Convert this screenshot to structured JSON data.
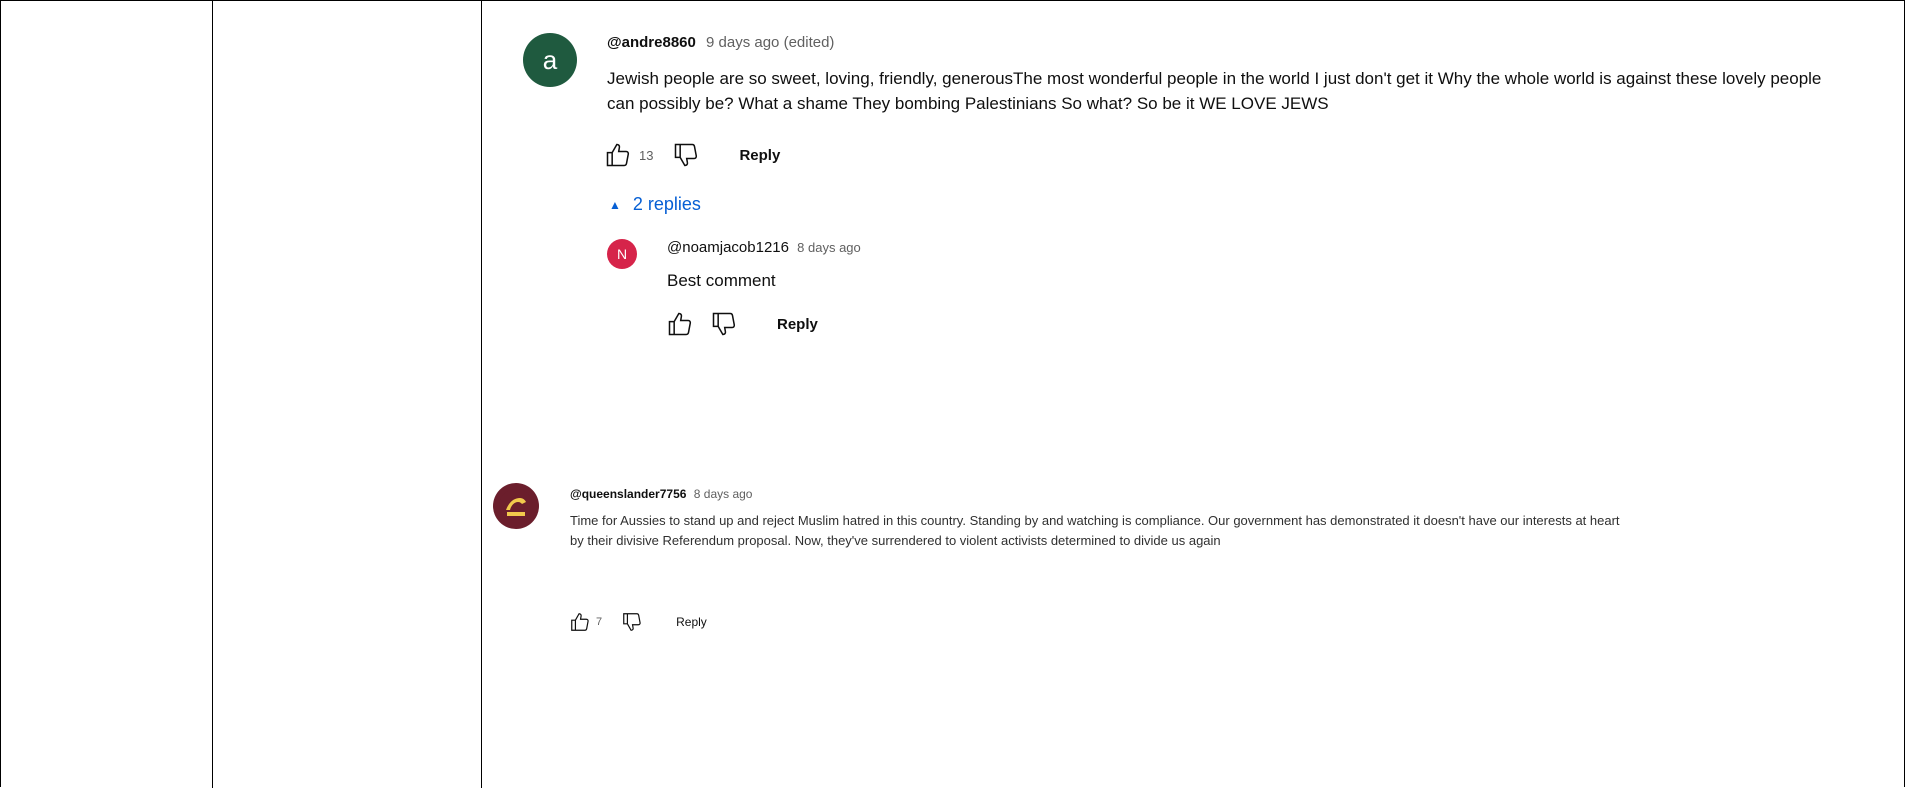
{
  "comments": [
    {
      "avatar_letter": "a",
      "avatar_color": "#1f5a3f",
      "author": "@andre8860",
      "time": "9 days ago (edited)",
      "text": "Jewish people are so sweet, loving, friendly, generousThe most wonderful people in the world I just don't get it Why the whole world is against these lovely people can possibly be? What a shame They bombing Palestinians So what? So be it WE LOVE JEWS",
      "likes": "13",
      "reply_label": "Reply",
      "replies_toggle": "2 replies",
      "replies": [
        {
          "avatar_letter": "N",
          "avatar_color": "#d6244a",
          "author": "@noamjacob1216",
          "time": "8 days ago",
          "text": "Best comment",
          "reply_label": "Reply"
        }
      ]
    },
    {
      "avatar_color": "#6b1e2c",
      "author": "@queenslander7756",
      "time": "8 days ago",
      "text": "Time for Aussies to stand up and reject Muslim hatred in this country. Standing by and watching is compliance. Our government has demonstrated it doesn't have our interests at heart by their divisive Referendum proposal. Now, they've surrendered to violent activists determined to divide us again",
      "likes": "7",
      "reply_label": "Reply"
    }
  ],
  "icons": {
    "like": "thumb-up-icon",
    "dislike": "thumb-down-icon",
    "collapse": "caret-up-icon"
  }
}
